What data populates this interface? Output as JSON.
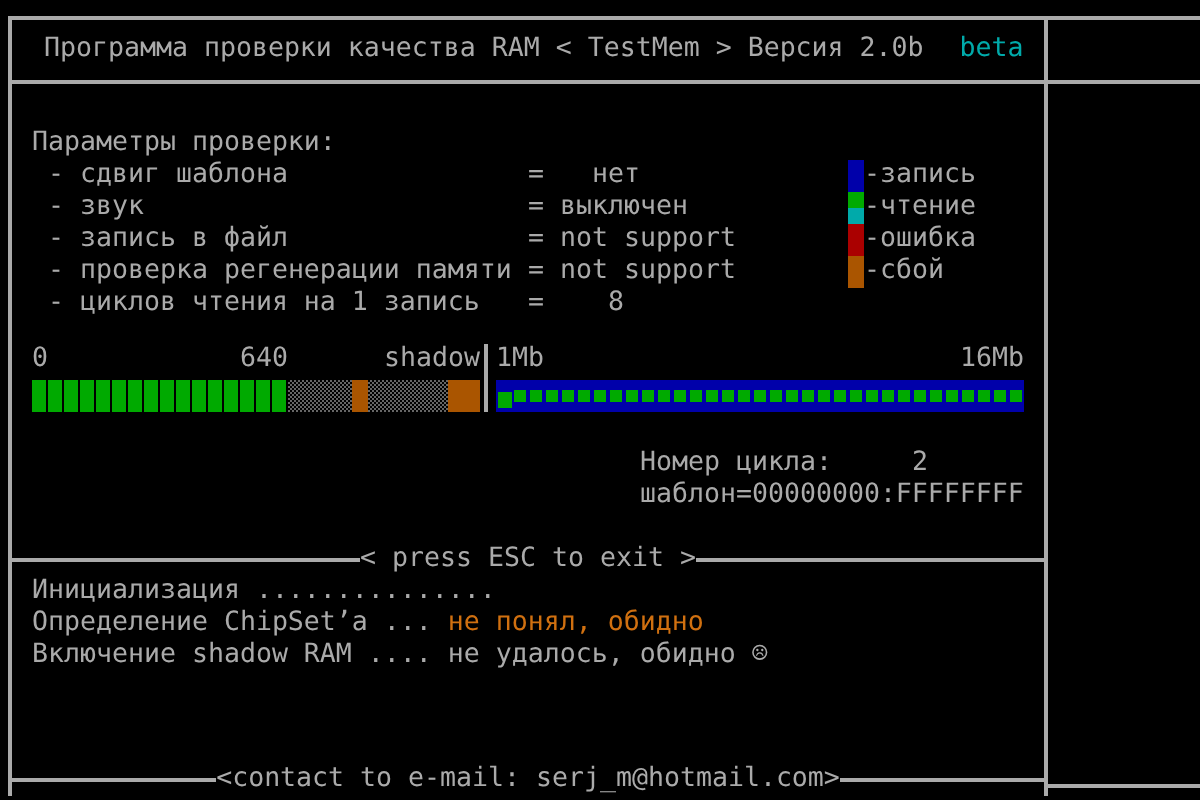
{
  "window": {
    "title": "Программа проверки качества RAM < TestMem > Версия 2.0b",
    "badge": "beta"
  },
  "parameters": {
    "heading": "Параметры проверки:",
    "items": [
      {
        "label": "- сдвиг шаблона",
        "value": "=   нет"
      },
      {
        "label": "- звук",
        "value": "= выключен"
      },
      {
        "label": "- запись в файл",
        "value": "= not support"
      },
      {
        "label": "- проверка регенерации памяти",
        "value": "= not support"
      },
      {
        "label": "- циклов чтения на 1 запись",
        "value": "=    8"
      }
    ]
  },
  "legend": [
    {
      "label": "-запись",
      "colors": [
        {
          "color": "#0000aa"
        }
      ]
    },
    {
      "label": "-чтение",
      "colors": [
        {
          "color": "#00aa00"
        },
        {
          "color": "#00aaaa"
        }
      ]
    },
    {
      "label": "-ошибка",
      "colors": [
        {
          "color": "#aa0000"
        }
      ]
    },
    {
      "label": "-сбой",
      "colors": [
        {
          "color": "#aa5500"
        }
      ]
    }
  ],
  "memory_map": {
    "low": {
      "labels": [
        "0",
        "640",
        "shadow"
      ],
      "blocks": [
        {
          "kind": "read"
        },
        {
          "kind": "read"
        },
        {
          "kind": "read"
        },
        {
          "kind": "read"
        },
        {
          "kind": "read"
        },
        {
          "kind": "read"
        },
        {
          "kind": "read"
        },
        {
          "kind": "read"
        },
        {
          "kind": "read"
        },
        {
          "kind": "read"
        },
        {
          "kind": "read"
        },
        {
          "kind": "read"
        },
        {
          "kind": "read"
        },
        {
          "kind": "read"
        },
        {
          "kind": "read"
        },
        {
          "kind": "read"
        },
        {
          "kind": "none"
        },
        {
          "kind": "none"
        },
        {
          "kind": "none"
        },
        {
          "kind": "none"
        },
        {
          "kind": "fail"
        },
        {
          "kind": "none"
        },
        {
          "kind": "none"
        },
        {
          "kind": "none"
        },
        {
          "kind": "none"
        },
        {
          "kind": "none"
        },
        {
          "kind": "fail"
        },
        {
          "kind": "fail"
        }
      ]
    },
    "high": {
      "labels": [
        "1Mb",
        "16Mb"
      ],
      "blocks": [
        {
          "kind": "current"
        },
        {
          "kind": "pending"
        },
        {
          "kind": "pending"
        },
        {
          "kind": "pending"
        },
        {
          "kind": "pending"
        },
        {
          "kind": "pending"
        },
        {
          "kind": "pending"
        },
        {
          "kind": "pending"
        },
        {
          "kind": "pending"
        },
        {
          "kind": "pending"
        },
        {
          "kind": "pending"
        },
        {
          "kind": "pending"
        },
        {
          "kind": "pending"
        },
        {
          "kind": "pending"
        },
        {
          "kind": "pending"
        },
        {
          "kind": "pending"
        },
        {
          "kind": "pending"
        },
        {
          "kind": "pending"
        },
        {
          "kind": "pending"
        },
        {
          "kind": "pending"
        },
        {
          "kind": "pending"
        },
        {
          "kind": "pending"
        },
        {
          "kind": "pending"
        },
        {
          "kind": "pending"
        },
        {
          "kind": "pending"
        },
        {
          "kind": "pending"
        },
        {
          "kind": "pending"
        },
        {
          "kind": "pending"
        },
        {
          "kind": "pending"
        },
        {
          "kind": "pending"
        },
        {
          "kind": "pending"
        },
        {
          "kind": "pending"
        },
        {
          "kind": "pending"
        }
      ]
    }
  },
  "cycle": {
    "label": "Номер цикла:",
    "value": "2",
    "pattern": "шаблон=00000000:FFFFFFFF"
  },
  "exit_hint": "< press ESC to exit >",
  "log": [
    {
      "text": "Инициализация ..............."
    },
    {
      "text": "Определение ChipSet’a ...",
      "status": {
        "text": "не понял, обидно",
        "kind": "warn"
      }
    },
    {
      "text": "Включение shadow RAM ....",
      "status": {
        "text": "не удалось, обидно ☹",
        "kind": "plain"
      }
    }
  ],
  "footer": "<contact to e-mail: serj_m@hotmail.com>"
}
